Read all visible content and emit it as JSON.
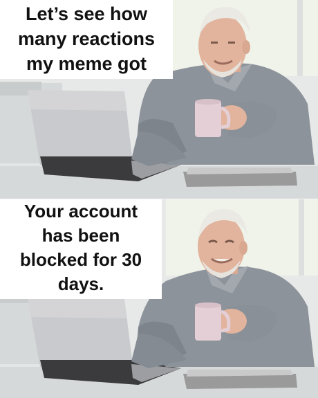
{
  "meme": {
    "top_caption": {
      "line1": "Let’s see how",
      "line2": "many reactions",
      "line3": "my meme got"
    },
    "bottom_caption": {
      "line1": "Your account",
      "line2": "has been",
      "line3": "blocked for 30",
      "line4": "days."
    }
  },
  "colors": {
    "wall": "#e6e9e8",
    "window": "#f4f6f2",
    "shirt": "#8e939b",
    "skin": "#e3b7a0",
    "hair": "#e9e7e2",
    "laptop": "#cfd0d2",
    "keyboard": "#3a3a3c",
    "mug": "#e3cfd6",
    "desk": "#d9dbdc"
  }
}
